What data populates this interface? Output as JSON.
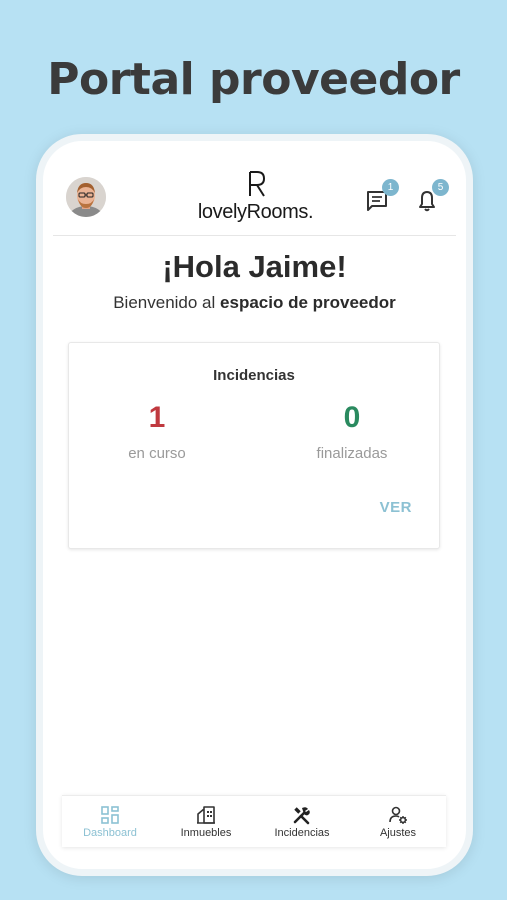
{
  "headline": "Portal proveedor",
  "header": {
    "logo_text": "lovelyRooms.",
    "messages_count": "1",
    "notifications_count": "5"
  },
  "greeting": "¡Hola Jaime!",
  "welcome": {
    "prefix": "Bienvenido al ",
    "strong": "espacio de proveedor"
  },
  "incidencias_card": {
    "title": "Incidencias",
    "in_progress_value": "1",
    "in_progress_label": "en curso",
    "finished_value": "0",
    "finished_label": "finalizadas",
    "link_label": "VER"
  },
  "bottom_nav": {
    "items": [
      {
        "label": "Dashboard",
        "icon": "dashboard-grid-icon",
        "active": true
      },
      {
        "label": "Inmuebles",
        "icon": "building-icon",
        "active": false
      },
      {
        "label": "Incidencias",
        "icon": "tools-icon",
        "active": false
      },
      {
        "label": "Ajustes",
        "icon": "user-settings-icon",
        "active": false
      }
    ]
  },
  "colors": {
    "background": "#b7e1f3",
    "accent": "#8cc1d3",
    "in_progress": "#c0393f",
    "finished": "#2a8a5f",
    "badge": "#7db6ce"
  }
}
